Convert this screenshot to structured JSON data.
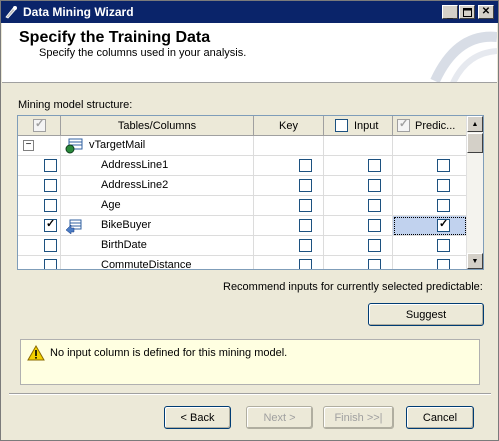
{
  "window": {
    "title": "Data Mining Wizard"
  },
  "header": {
    "title": "Specify the Training Data",
    "subtitle": "Specify the columns used in your analysis."
  },
  "structure_label": "Mining model structure:",
  "grid": {
    "columns": [
      "Tables/Columns",
      "Key",
      "Input",
      "Predic..."
    ],
    "table": {
      "name": "vTargetMail"
    },
    "rows": [
      {
        "name": "AddressLine1"
      },
      {
        "name": "AddressLine2"
      },
      {
        "name": "Age"
      },
      {
        "name": "BikeBuyer"
      },
      {
        "name": "BirthDate"
      },
      {
        "name": "CommuteDistance"
      }
    ]
  },
  "recommend_text": "Recommend inputs for currently selected predictable:",
  "suggest_label": "Suggest",
  "message": "No input column is defined for this mining model.",
  "footer": {
    "back": "< Back",
    "next": "Next >",
    "finish": "Finish >>|",
    "cancel": "Cancel"
  },
  "icons": {
    "app": "wizard-icon",
    "warning": "warning-icon",
    "table": "table-icon",
    "key": "key-column-icon"
  },
  "colors": {
    "titlebar": "#0a246a",
    "selection": "#c1d2ee",
    "message_bg": "#ffffe1"
  }
}
